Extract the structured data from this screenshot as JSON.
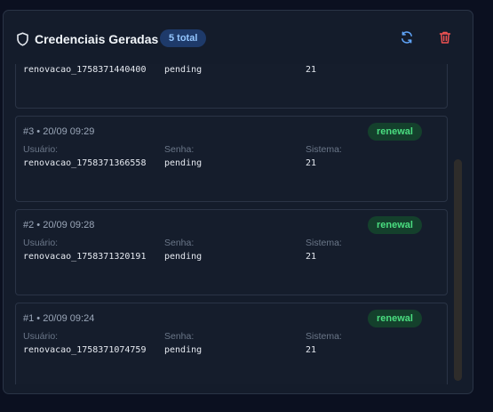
{
  "panel": {
    "title": "Credenciais Geradas",
    "count_label": "5 total",
    "icons": {
      "title": "shield-icon",
      "refresh": "refresh-icon",
      "delete": "trash-icon"
    },
    "colors": {
      "accent_blue": "#60a5fa",
      "danger_red": "#f05252",
      "success_green": "#4ade80"
    }
  },
  "labels": {
    "user": "Usuário:",
    "password": "Senha:",
    "system": "Sistema:"
  },
  "credentials": [
    {
      "header": "",
      "type": "",
      "user": "renovacao_1758371440400",
      "password": "pending",
      "system": "21"
    },
    {
      "header": "#3 • 20/09 09:29",
      "type": "renewal",
      "user": "renovacao_1758371366558",
      "password": "pending",
      "system": "21"
    },
    {
      "header": "#2 • 20/09 09:28",
      "type": "renewal",
      "user": "renovacao_1758371320191",
      "password": "pending",
      "system": "21"
    },
    {
      "header": "#1 • 20/09 09:24",
      "type": "renewal",
      "user": "renovacao_1758371074759",
      "password": "pending",
      "system": "21"
    }
  ]
}
